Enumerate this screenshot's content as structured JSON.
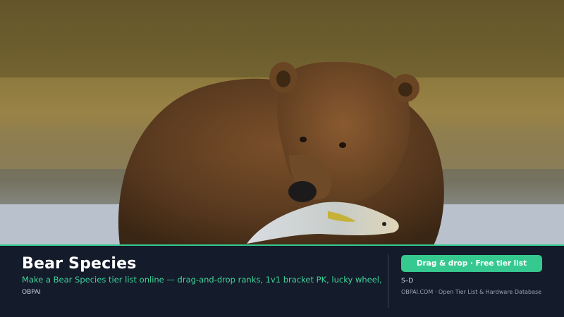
{
  "header": {
    "title": "Bear Species",
    "description": "Make a Bear Species tier list online — drag-and-drop ranks, 1v1 bracket PK, lucky wheel, a",
    "brand": "OBPAI"
  },
  "aside": {
    "cta_label": "Drag & drop · Free tier list",
    "tier_range": "S–D",
    "site_caption": "OBPAI.COM · Open Tier List & Hardware Database"
  },
  "colors": {
    "accent": "#35c98f",
    "panel_background": "#141b2a"
  },
  "hero": {
    "subject": "brown bear holding salmon in river"
  }
}
